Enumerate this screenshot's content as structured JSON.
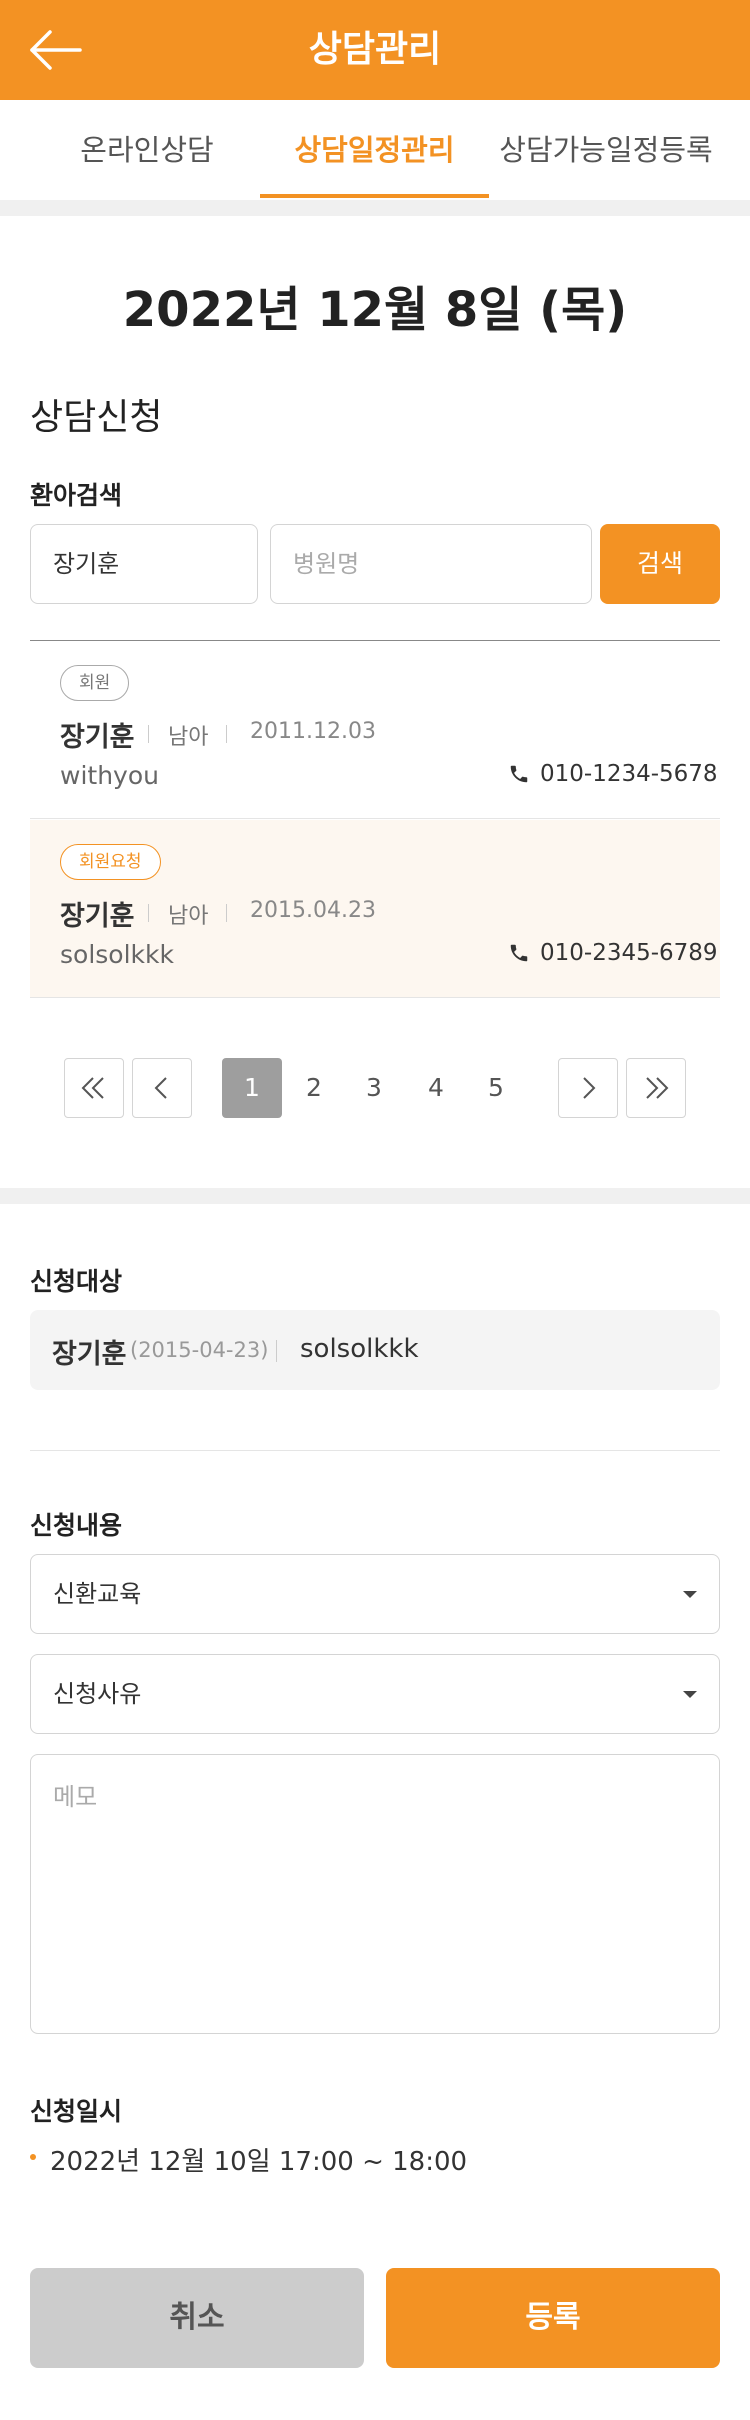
{
  "header": {
    "title": "상담관리",
    "back_icon": "arrow-left-icon"
  },
  "tabs": [
    {
      "label": "온라인상담",
      "active": false
    },
    {
      "label": "상담일정관리",
      "active": true
    },
    {
      "label": "상담가능일정등록",
      "active": false
    }
  ],
  "date_title": "2022년 12월 8일 (목)",
  "apply": {
    "section_title": "상담신청",
    "search_label": "환아검색",
    "name_value": "장기훈",
    "hospital_placeholder": "병원명",
    "search_button": "검색"
  },
  "results": [
    {
      "badge": "회원",
      "name": "장기훈",
      "gender": "남아",
      "birth": "2011.12.03",
      "user_id": "withyou",
      "phone": "010-1234-5678",
      "highlighted": false
    },
    {
      "badge": "회원요청",
      "name": "장기훈",
      "gender": "남아",
      "birth": "2015.04.23",
      "user_id": "solsolkkk",
      "phone": "010-2345-6789",
      "highlighted": true
    }
  ],
  "pagination": {
    "pages": [
      "1",
      "2",
      "3",
      "4",
      "5"
    ],
    "current": "1"
  },
  "target": {
    "label": "신청대상",
    "name": "장기훈",
    "birth": "(2015-04-23)",
    "user_id": "solsolkkk"
  },
  "content": {
    "label": "신청내용",
    "type_value": "신환교육",
    "reason_value": "신청사유",
    "memo_placeholder": "메모"
  },
  "schedule": {
    "label": "신청일시",
    "value": "2022년 12월 10일 17:00 ~ 18:00"
  },
  "buttons": {
    "cancel": "취소",
    "submit": "등록"
  },
  "colors": {
    "accent": "#f39223",
    "highlight_row": "#fdf7f0",
    "page_active": "#9e9e9e"
  }
}
